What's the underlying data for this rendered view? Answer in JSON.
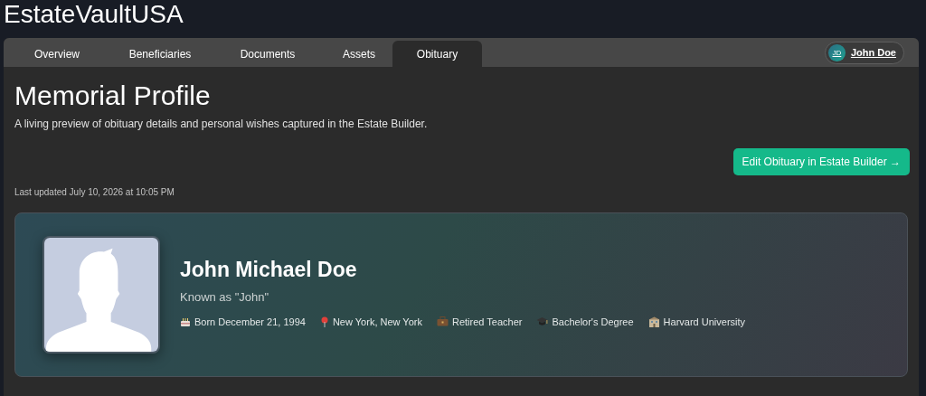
{
  "app": {
    "title": "EstateVaultUSA"
  },
  "tabs": [
    {
      "label": "Overview",
      "selected": false
    },
    {
      "label": "Beneficiaries",
      "selected": false
    },
    {
      "label": "Documents",
      "selected": false
    },
    {
      "label": "Assets",
      "selected": false
    },
    {
      "label": "Obituary",
      "selected": true
    }
  ],
  "user": {
    "initials": "JD",
    "name": "John Doe"
  },
  "page": {
    "title": "Memorial Profile",
    "subtitle": "A living preview of obituary details and personal wishes captured in the Estate Builder.",
    "action": "Edit Obituary in Estate Builder →",
    "updated": "Last updated July 10, 2026 at 10:05 PM"
  },
  "profile": {
    "name": "John Michael Doe",
    "nickname": "Known as \"John\"",
    "facts": [
      {
        "kind": "birth",
        "text": "Born December 21, 1994"
      },
      {
        "kind": "place",
        "text": "New York, New York"
      },
      {
        "kind": "work",
        "text": "Retired Teacher"
      },
      {
        "kind": "degree",
        "text": "Bachelor's Degree"
      },
      {
        "kind": "school",
        "text": "Harvard University"
      }
    ]
  }
}
